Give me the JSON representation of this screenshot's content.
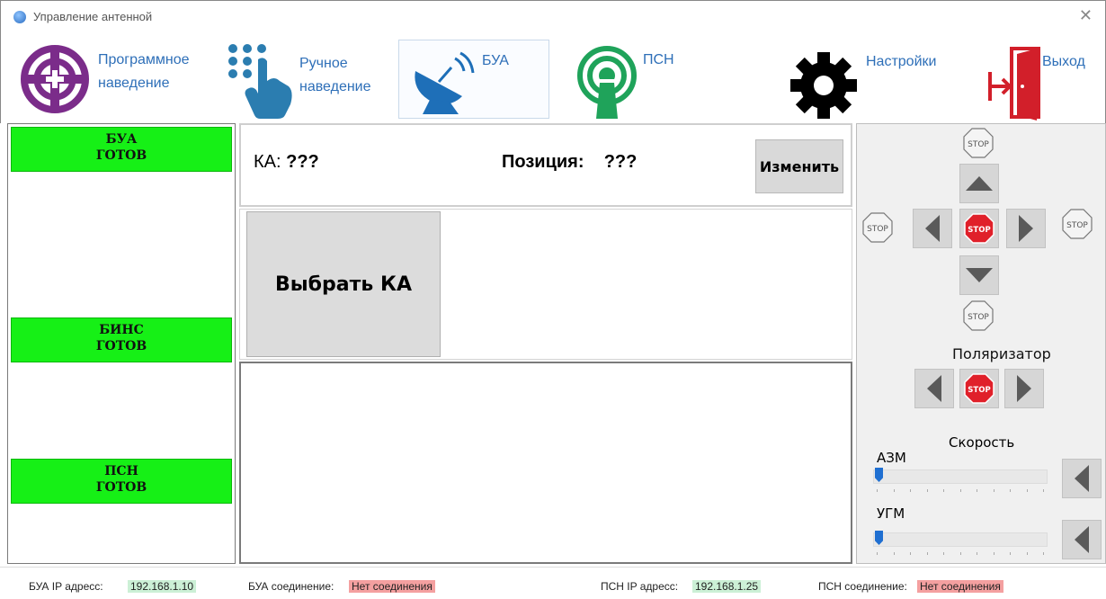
{
  "window": {
    "title": "Управление антенной"
  },
  "toolbar": {
    "program_line1": "Программное",
    "program_line2": "наведение",
    "manual_line1": "Ручное",
    "manual_line2": "наведение",
    "bua": "БУА",
    "psn": "ПСН",
    "settings": "Настройки",
    "exit": "Выход"
  },
  "status": {
    "bua_line1": "БУА",
    "bua_line2": "ГОТОВ",
    "bins_line1": "БИНС",
    "bins_line2": "ГОТОВ",
    "psn_line1": "ПСН",
    "psn_line2": "ГОТОВ",
    "ready_color": "#16f016"
  },
  "center": {
    "ka_label": "КА:",
    "ka_value": "???",
    "position_label": "Позиция:",
    "position_value": "???",
    "change_button": "Изменить",
    "select_ka_button": "Выбрать КА"
  },
  "control": {
    "stop_text": "STOP",
    "polarizer_label": "Поляризатор",
    "speed_label": "Скорость",
    "azm_label": "АЗМ",
    "ugm_label": "УГМ",
    "azm_value": 0,
    "ugm_value": 0
  },
  "statusbar": {
    "bua_ip_label": "БУА IP адресс:",
    "bua_ip": "192.168.1.10",
    "bua_conn_label": "БУА соединение:",
    "bua_conn": "Нет соединения",
    "psn_ip_label": "ПСН IP адресс:",
    "psn_ip": "192.168.1.25",
    "psn_conn_label": "ПСН соединение:",
    "psn_conn": "Нет соединения"
  }
}
